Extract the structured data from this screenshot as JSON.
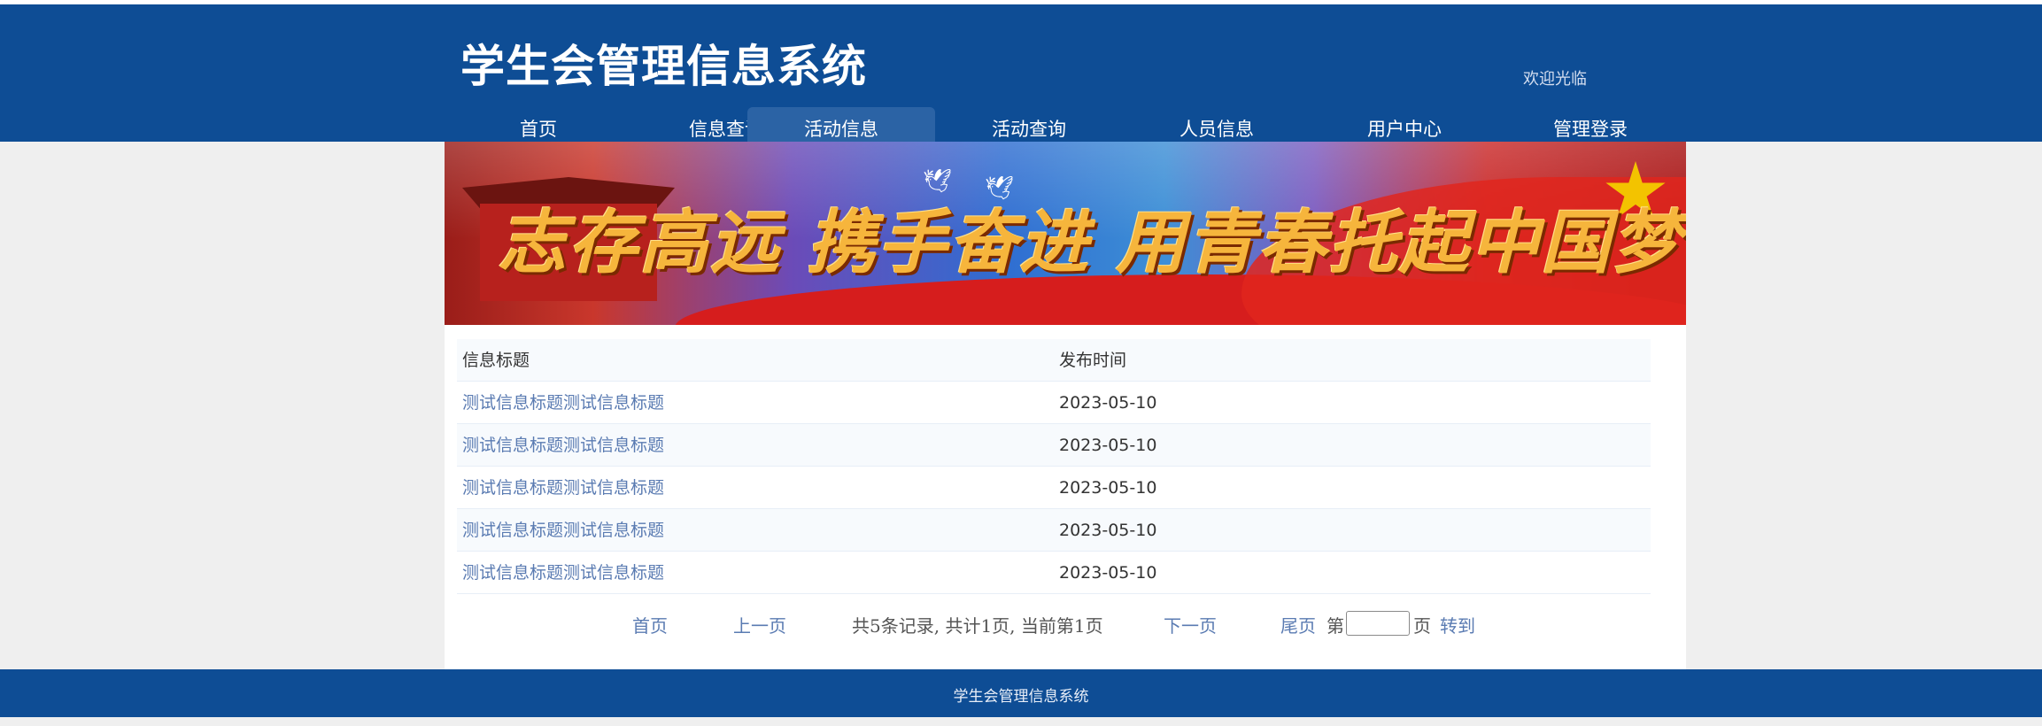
{
  "header": {
    "site_title": "学生会管理信息系统",
    "welcome": "欢迎光临"
  },
  "nav": {
    "items": [
      {
        "label": "首页"
      },
      {
        "label": "信息查询"
      },
      {
        "label": "活动信息",
        "active": true
      },
      {
        "label": "活动查询"
      },
      {
        "label": "人员信息"
      },
      {
        "label": "用户中心"
      },
      {
        "label": "管理登录"
      }
    ]
  },
  "banner": {
    "slogan": "志存高远  携手奋进  用青春托起中国梦"
  },
  "table": {
    "columns": [
      "信息标题",
      "发布时间"
    ],
    "rows": [
      {
        "title": "测试信息标题测试信息标题",
        "date": "2023-05-10"
      },
      {
        "title": "测试信息标题测试信息标题",
        "date": "2023-05-10"
      },
      {
        "title": "测试信息标题测试信息标题",
        "date": "2023-05-10"
      },
      {
        "title": "测试信息标题测试信息标题",
        "date": "2023-05-10"
      },
      {
        "title": "测试信息标题测试信息标题",
        "date": "2023-05-10"
      }
    ]
  },
  "pager": {
    "first": "首页",
    "prev": "上一页",
    "summary": "共5条记录, 共计1页, 当前第1页",
    "next": "下一页",
    "last": "尾页",
    "page_prefix": "第",
    "page_suffix": "页",
    "goto": "转到",
    "page_input_value": ""
  },
  "footer": {
    "text": "学生会管理信息系统"
  },
  "colors": {
    "brand_blue": "#0e4d95",
    "active_tab": "#2b63a5",
    "link": "#5a7bb2"
  }
}
